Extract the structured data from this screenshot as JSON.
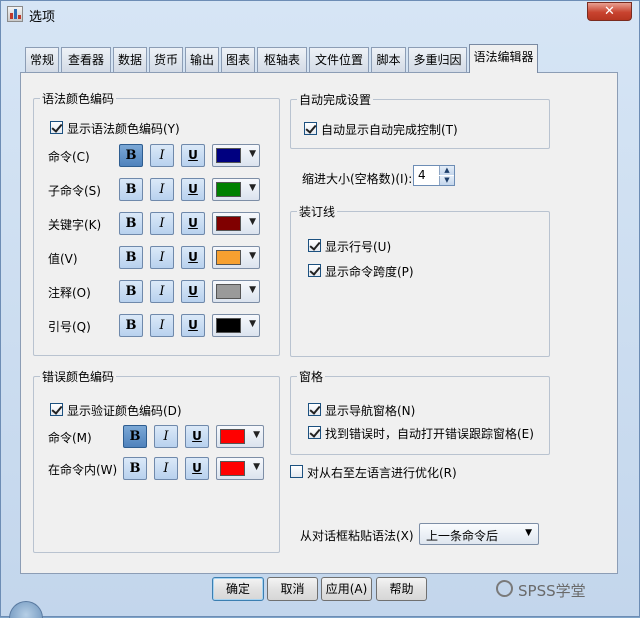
{
  "window": {
    "title": "选项",
    "close_symbol": "✕"
  },
  "tabs": [
    "常规",
    "查看器",
    "数据",
    "货币",
    "输出",
    "图表",
    "枢轴表",
    "文件位置",
    "脚本",
    "多重归因",
    "语法编辑器"
  ],
  "active_tab": "语法编辑器",
  "syntax_coloring": {
    "title": "语法颜色编码",
    "show_label": "显示语法颜色编码(Y)",
    "show_checked": true,
    "rows": [
      {
        "label": "命令(C)",
        "bold": true,
        "italic": false,
        "underline": false,
        "color": "#000080"
      },
      {
        "label": "子命令(S)",
        "bold": false,
        "italic": false,
        "underline": false,
        "color": "#008000"
      },
      {
        "label": "关键字(K)",
        "bold": false,
        "italic": false,
        "underline": false,
        "color": "#800000"
      },
      {
        "label": "值(V)",
        "bold": false,
        "italic": false,
        "underline": false,
        "color": "#f7a030"
      },
      {
        "label": "注释(O)",
        "bold": false,
        "italic": false,
        "underline": false,
        "color": "#9a9a9a"
      },
      {
        "label": "引号(Q)",
        "bold": false,
        "italic": false,
        "underline": false,
        "color": "#000000"
      }
    ],
    "format_glyphs": {
      "bold": "B",
      "italic": "I",
      "underline": "U"
    }
  },
  "error_coloring": {
    "title": "错误颜色编码",
    "show_label": "显示验证颜色编码(D)",
    "show_checked": true,
    "rows": [
      {
        "label": "命令(M)",
        "bold": true,
        "italic": false,
        "underline": false,
        "color": "#ff0000"
      },
      {
        "label": "在命令内(W)",
        "bold": false,
        "italic": false,
        "underline": false,
        "color": "#ff0000"
      }
    ]
  },
  "autocomplete": {
    "title": "自动完成设置",
    "show_label": "自动显示自动完成控制(T)",
    "show_checked": true
  },
  "indent": {
    "label": "缩进大小(空格数)(I):",
    "value": "4"
  },
  "gutter": {
    "title": "装订线",
    "line_numbers_label": "显示行号(U)",
    "line_numbers_checked": true,
    "command_spans_label": "显示命令跨度(P)",
    "command_spans_checked": true
  },
  "panes": {
    "title": "窗格",
    "nav_label": "显示导航窗格(N)",
    "nav_checked": true,
    "error_track_label": "找到错误时，自动打开错误跟踪窗格(E)",
    "error_track_checked": true
  },
  "rtl": {
    "label": "对从右至左语言进行优化(R)",
    "checked": false
  },
  "paste": {
    "label": "从对话框粘贴语法(X)",
    "value": "上一条命令后"
  },
  "buttons": {
    "ok": "确定",
    "cancel": "取消",
    "apply": "应用(A)",
    "help": "帮助"
  },
  "watermark": "SPSS学堂"
}
